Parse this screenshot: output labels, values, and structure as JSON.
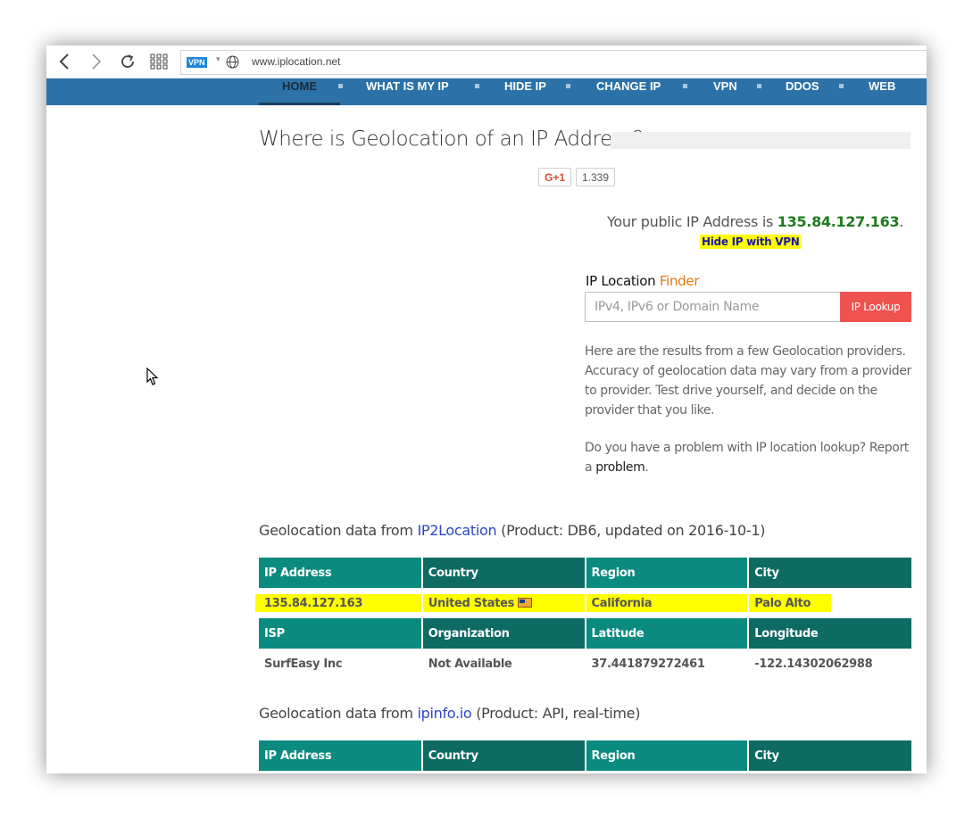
{
  "browser": {
    "back_icon": "chevron-left-icon",
    "forward_icon": "chevron-right-icon",
    "reload_icon": "reload-icon",
    "apps_icon": "grid-icon",
    "vpn_badge": "VPN",
    "url": "www.iplocation.net"
  },
  "nav": {
    "items": [
      {
        "label": "HOME"
      },
      {
        "label": "WHAT IS MY IP"
      },
      {
        "label": "HIDE IP"
      },
      {
        "label": "CHANGE IP"
      },
      {
        "label": "VPN"
      },
      {
        "label": "DDOS"
      },
      {
        "label": "WEB"
      }
    ]
  },
  "page": {
    "title": "Where is Geolocation of an IP Address?",
    "gplus_label": "G+1",
    "gplus_count": "1.339",
    "public_ip_prefix": "Your public IP Address is ",
    "public_ip": "135.84.127.163",
    "public_ip_suffix": ".",
    "hide_ip_link": "Hide IP with VPN"
  },
  "finder": {
    "title_main": "IP Location ",
    "title_accent": "Finder",
    "placeholder": "IPv4, IPv6 or Domain Name",
    "button": "IP Lookup"
  },
  "info": {
    "para1": "Here are the results from a few Geolocation providers. Accuracy of geolocation data may vary from a provider to provider. Test drive yourself, and decide on the provider that you like.",
    "para2_prefix": "Do you have a problem with IP location lookup? Report a ",
    "para2_link": "problem",
    "para2_suffix": "."
  },
  "section1": {
    "prefix": "Geolocation data from ",
    "provider": "IP2Location",
    "suffix": " (Product: DB6, updated on 2016-10-1)",
    "header1": [
      "IP Address",
      "Country",
      "Region",
      "City"
    ],
    "row1": [
      "135.84.127.163",
      "United States",
      "California",
      "Palo Alto"
    ],
    "header2": [
      "ISP",
      "Organization",
      "Latitude",
      "Longitude"
    ],
    "row2": [
      "SurfEasy Inc",
      "Not Available",
      "37.441879272461",
      "-122.14302062988"
    ]
  },
  "section2": {
    "prefix": "Geolocation data from ",
    "provider": "ipinfo.io",
    "suffix": " (Product: API, real-time)",
    "header1": [
      "IP Address",
      "Country",
      "Region",
      "City"
    ]
  },
  "colors": {
    "nav_bg": "#2c72a8",
    "table_header_a": "#0b8b80",
    "table_header_b": "#0d6b63",
    "highlight": "#ffff00",
    "ip_green": "#1e7b1e",
    "lookup_button": "#ef5350",
    "finder_accent": "#e07a10",
    "link_blue": "#2b46c5"
  }
}
